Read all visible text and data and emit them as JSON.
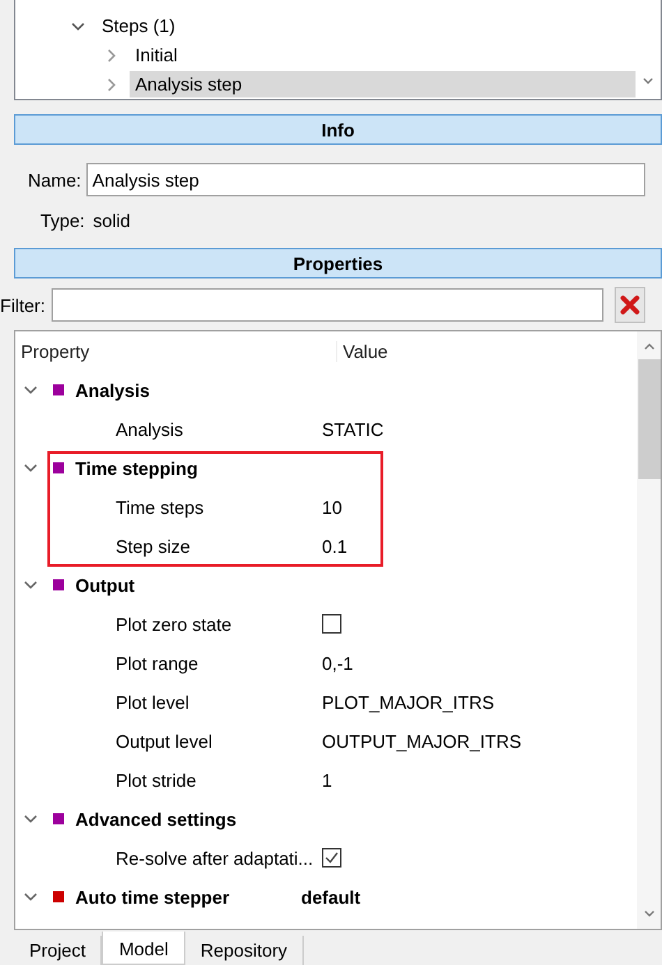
{
  "tree": {
    "items": [
      {
        "label": "Steps (1)",
        "expanded": true,
        "selected": false,
        "children": [
          {
            "label": "Initial",
            "expanded": false,
            "selected": false
          },
          {
            "label": "Analysis step",
            "expanded": false,
            "selected": true
          }
        ]
      }
    ]
  },
  "info": {
    "title": "Info",
    "name_label": "Name:",
    "name_value": "Analysis step",
    "type_label": "Type:",
    "type_value": "solid"
  },
  "properties": {
    "title": "Properties",
    "filter_label": "Filter:",
    "columns": [
      "Property",
      "Value"
    ],
    "groups": [
      {
        "label": "Analysis",
        "color": "#9c009c",
        "expanded": true,
        "highlighted": false,
        "rows": [
          {
            "kind": "text",
            "label": "Analysis",
            "value": "STATIC"
          }
        ]
      },
      {
        "label": "Time stepping",
        "color": "#9c009c",
        "expanded": true,
        "highlighted": true,
        "rows": [
          {
            "kind": "text",
            "label": "Time steps",
            "value": "10"
          },
          {
            "kind": "text",
            "label": "Step size",
            "value": "0.1"
          }
        ]
      },
      {
        "label": "Output",
        "color": "#9c009c",
        "expanded": true,
        "highlighted": false,
        "rows": [
          {
            "kind": "checkbox",
            "label": "Plot zero state",
            "checked": false
          },
          {
            "kind": "text",
            "label": "Plot range",
            "value": "0,-1"
          },
          {
            "kind": "text",
            "label": "Plot level",
            "value": "PLOT_MAJOR_ITRS"
          },
          {
            "kind": "text",
            "label": "Output level",
            "value": "OUTPUT_MAJOR_ITRS"
          },
          {
            "kind": "text",
            "label": "Plot stride",
            "value": "1"
          }
        ]
      },
      {
        "label": "Advanced settings",
        "color": "#9c009c",
        "expanded": true,
        "highlighted": false,
        "rows": [
          {
            "kind": "checkbox",
            "label": "Re-solve after adaptati...",
            "checked": true
          }
        ]
      },
      {
        "label": "Auto time stepper",
        "color": "#cc0000",
        "expanded": true,
        "highlighted": false,
        "value": "default"
      }
    ]
  },
  "tabs": [
    {
      "label": "Project",
      "selected": false
    },
    {
      "label": "Model",
      "selected": true
    },
    {
      "label": "Repository",
      "selected": false
    }
  ]
}
